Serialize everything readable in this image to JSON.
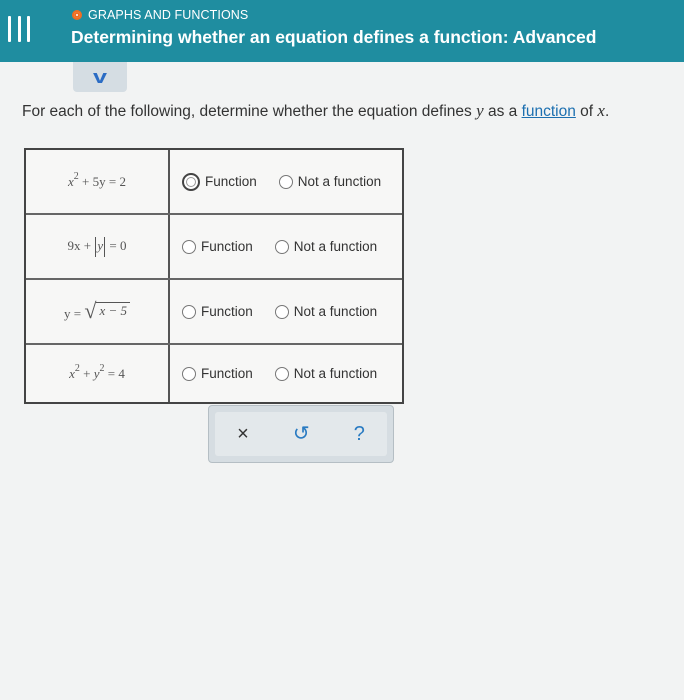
{
  "header": {
    "topic": "GRAPHS AND FUNCTIONS",
    "title": "Determining whether an equation defines a function: Advanced"
  },
  "instructions": {
    "prefix": "For each of the following, determine whether the equation defines ",
    "var_y": "y",
    "middle": " as a ",
    "link": "function",
    "of": " of ",
    "var_x": "x",
    "end": "."
  },
  "rows": [
    {
      "option_a": "Function",
      "option_b": "Not a function"
    },
    {
      "option_a": "Function",
      "option_b": "Not a function"
    },
    {
      "option_a": "Function",
      "option_b": "Not a function"
    },
    {
      "option_a": "Function",
      "option_b": "Not a function"
    }
  ],
  "equations": {
    "e1": {
      "x": "x",
      "exp": "2",
      "rest": " + 5y = 2"
    },
    "e2": {
      "lead": "9x + ",
      "var": "y",
      "rest": " = 0"
    },
    "e3": {
      "lead": "y = ",
      "radicand": "x − 5"
    },
    "e4": {
      "x": "x",
      "exp1": "2",
      "plus": " + ",
      "y": "y",
      "exp2": "2",
      "rest": " = 4"
    }
  },
  "actions": {
    "clear": "×",
    "undo": "↺",
    "help": "?"
  }
}
